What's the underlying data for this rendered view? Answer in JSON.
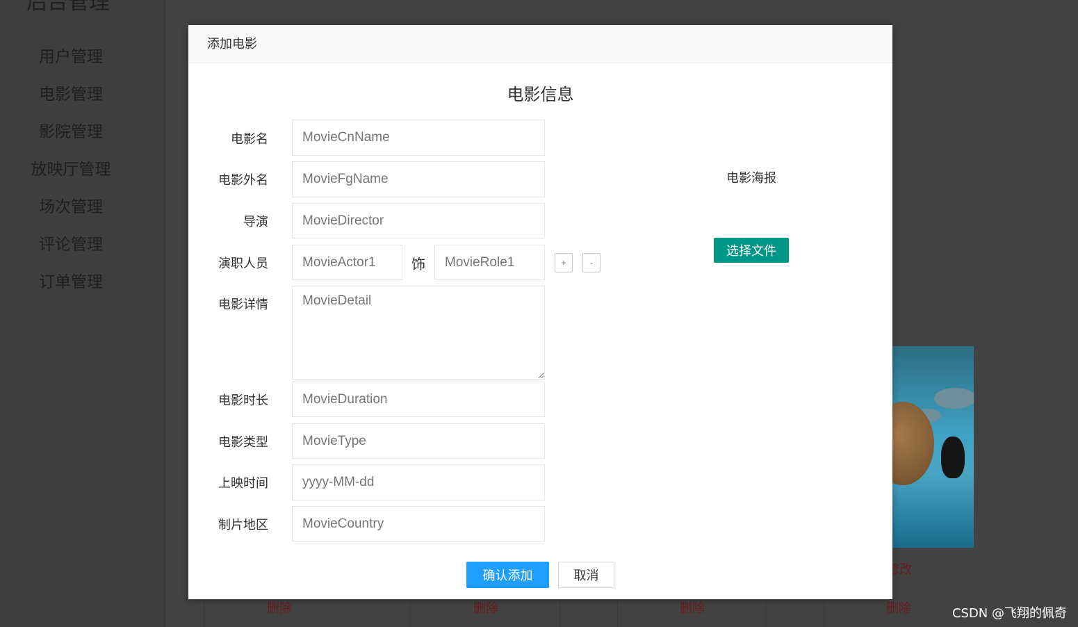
{
  "sidebar": {
    "title": "后台管理",
    "items": [
      {
        "label": "用户管理"
      },
      {
        "label": "电影管理"
      },
      {
        "label": "影院管理"
      },
      {
        "label": "放映厅管理"
      },
      {
        "label": "场次管理"
      },
      {
        "label": "评论管理"
      },
      {
        "label": "订单管理"
      }
    ]
  },
  "background": {
    "delete_label": "删除",
    "edit_label": "修改"
  },
  "modal": {
    "header": "添加电影",
    "form_title": "电影信息",
    "fields": {
      "cn_name": {
        "label": "电影名",
        "placeholder": "MovieCnName"
      },
      "fg_name": {
        "label": "电影外名",
        "placeholder": "MovieFgName"
      },
      "director": {
        "label": "导演",
        "placeholder": "MovieDirector"
      },
      "actor": {
        "label": "演职人员",
        "placeholder": "MovieActor1",
        "as_label": "饰",
        "role_placeholder": "MovieRole1"
      },
      "detail": {
        "label": "电影详情",
        "placeholder": "MovieDetail"
      },
      "duration": {
        "label": "电影时长",
        "placeholder": "MovieDuration"
      },
      "type": {
        "label": "电影类型",
        "placeholder": "MovieType"
      },
      "release": {
        "label": "上映时间",
        "placeholder": "yyyy-MM-dd"
      },
      "country": {
        "label": "制片地区",
        "placeholder": "MovieCountry"
      }
    },
    "add_actor_label": "+",
    "remove_actor_label": "-",
    "poster_label": "电影海报",
    "choose_file_label": "选择文件",
    "confirm_label": "确认添加",
    "cancel_label": "取消"
  },
  "watermark": "CSDN @飞翔的佩奇",
  "colors": {
    "primary_blue": "#1e9fff",
    "teal": "#009688",
    "overlay": "#424242"
  }
}
